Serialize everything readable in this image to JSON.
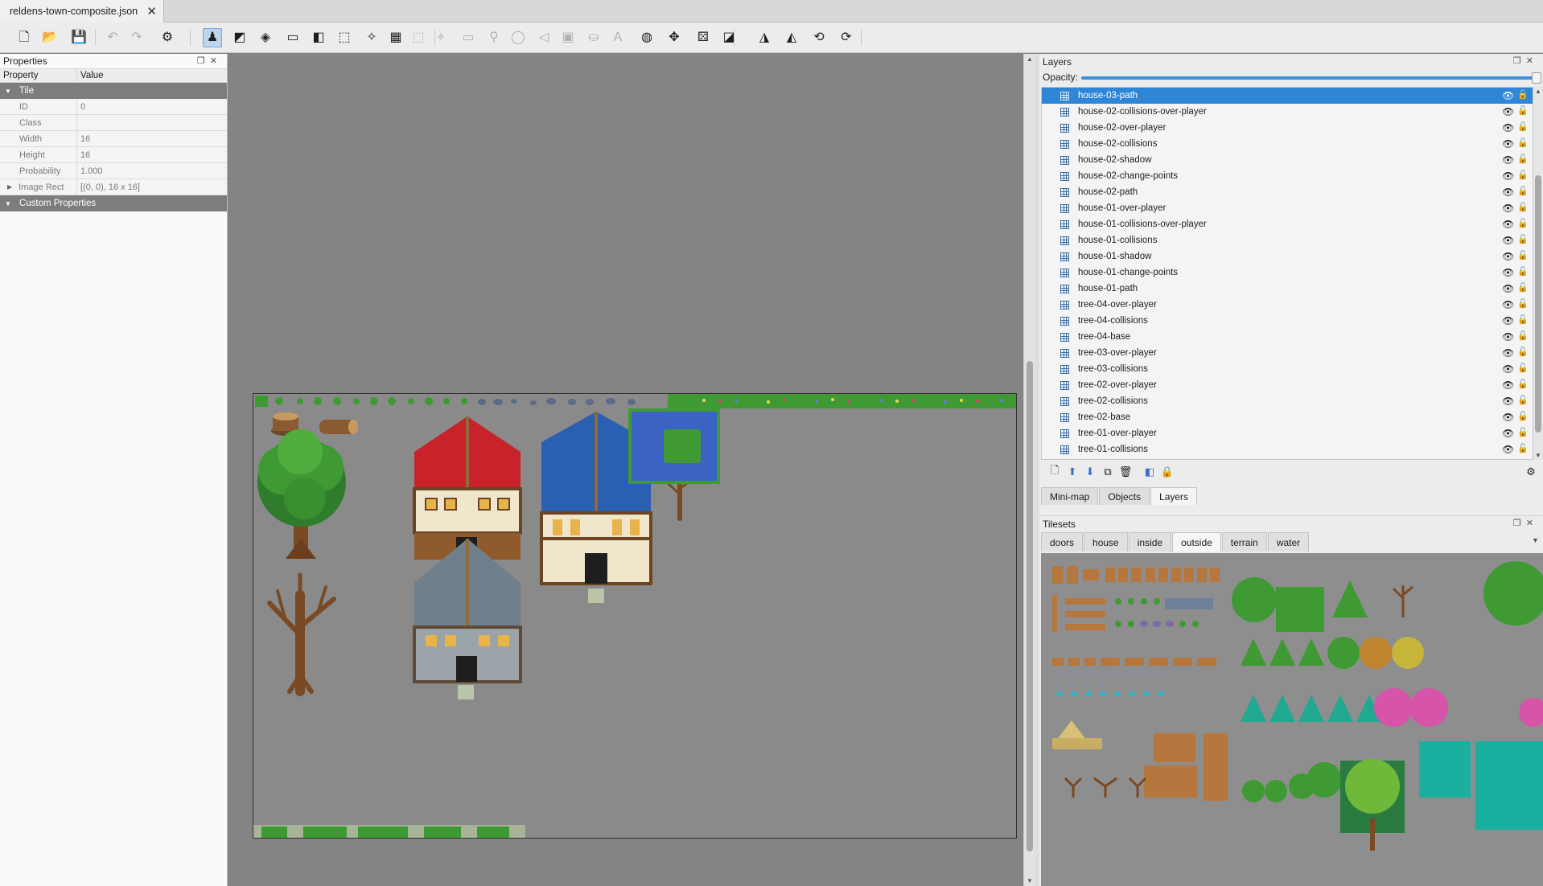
{
  "document_tab": {
    "title": "reldens-town-composite.json",
    "close": "✕"
  },
  "toolbar": {
    "buttons": [
      {
        "name": "new-map-icon",
        "glyph": "🗋"
      },
      {
        "name": "open-icon",
        "glyph": "📂"
      },
      {
        "name": "save-icon",
        "glyph": "💾"
      },
      {
        "name": "undo-icon",
        "glyph": "↶"
      },
      {
        "name": "redo-icon",
        "glyph": "↷"
      },
      {
        "name": "commands-icon",
        "glyph": "⚙"
      },
      {
        "name": "stamp-brush-icon",
        "glyph": "♟"
      },
      {
        "name": "terrain-brush-icon",
        "glyph": "◩"
      },
      {
        "name": "bucket-fill-icon",
        "glyph": "◈"
      },
      {
        "name": "shape-fill-icon",
        "glyph": "▭"
      },
      {
        "name": "eraser-icon",
        "glyph": "◧"
      },
      {
        "name": "rect-select-icon",
        "glyph": "⬚"
      },
      {
        "name": "magic-wand-icon",
        "glyph": "✧"
      },
      {
        "name": "select-same-tile-icon",
        "glyph": "▦"
      },
      {
        "name": "select-objects-icon",
        "glyph": "⬚"
      },
      {
        "name": "edit-polygons-icon",
        "glyph": "⌖"
      },
      {
        "name": "insert-rectangle-icon",
        "glyph": "▭"
      },
      {
        "name": "insert-point-icon",
        "glyph": "⚲"
      },
      {
        "name": "insert-ellipse-icon",
        "glyph": "◯"
      },
      {
        "name": "insert-polygon-icon",
        "glyph": "◁"
      },
      {
        "name": "insert-tile-icon",
        "glyph": "▣"
      },
      {
        "name": "insert-template-icon",
        "glyph": "⛀"
      },
      {
        "name": "insert-text-icon",
        "glyph": "A"
      },
      {
        "name": "world-tool-icon",
        "glyph": "◍"
      },
      {
        "name": "move-icon",
        "glyph": "✥"
      },
      {
        "name": "random-mode-icon",
        "glyph": "⚄"
      },
      {
        "name": "wang-fill-icon",
        "glyph": "◪"
      },
      {
        "name": "flip-horizontal-icon",
        "glyph": "◮"
      },
      {
        "name": "flip-vertical-icon",
        "glyph": "◭"
      },
      {
        "name": "rotate-left-icon",
        "glyph": "⟲"
      },
      {
        "name": "rotate-right-icon",
        "glyph": "⟳"
      }
    ]
  },
  "properties": {
    "title": "Properties",
    "col_property": "Property",
    "col_value": "Value",
    "group_tile": "Tile",
    "rows": [
      {
        "key": "ID",
        "value": "0"
      },
      {
        "key": "Class",
        "value": ""
      },
      {
        "key": "Width",
        "value": "16"
      },
      {
        "key": "Height",
        "value": "16"
      },
      {
        "key": "Probability",
        "value": "1.000"
      },
      {
        "key": "Image Rect",
        "value": "[(0, 0), 16 x 16]"
      }
    ],
    "group_custom": "Custom Properties"
  },
  "layers": {
    "title": "Layers",
    "opacity_label": "Opacity:",
    "opacity_value": 1.0,
    "items": [
      "house-03-path",
      "house-02-collisions-over-player",
      "house-02-over-player",
      "house-02-collisions",
      "house-02-shadow",
      "house-02-change-points",
      "house-02-path",
      "house-01-over-player",
      "house-01-collisions-over-player",
      "house-01-collisions",
      "house-01-shadow",
      "house-01-change-points",
      "house-01-path",
      "tree-04-over-player",
      "tree-04-collisions",
      "tree-04-base",
      "tree-03-over-player",
      "tree-03-collisions",
      "tree-02-over-player",
      "tree-02-collisions",
      "tree-02-base",
      "tree-01-over-player",
      "tree-01-collisions"
    ],
    "selected": "house-03-path"
  },
  "panel_tabs": [
    "Mini-map",
    "Objects",
    "Layers"
  ],
  "active_panel_tab": "Layers",
  "tilesets": {
    "title": "Tilesets",
    "tabs": [
      "doors",
      "house",
      "inside",
      "outside",
      "terrain",
      "water"
    ],
    "active": "outside"
  },
  "colors": {
    "selection": "#2f86d6",
    "canvas": "#848484",
    "roof_red": "#c8232b",
    "roof_blue": "#2b5fb0",
    "roof_gray": "#6f7f8c",
    "water": "#3a63c4",
    "foliage": "#3f9a34"
  }
}
